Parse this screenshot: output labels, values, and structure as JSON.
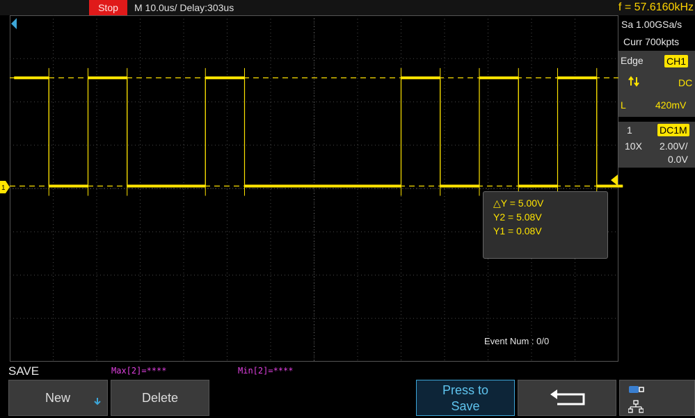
{
  "topbar": {
    "status": "Stop",
    "timebase": "M 10.0us/  Delay:303us",
    "frequency": "f = 57.6160kHz"
  },
  "acquisition": {
    "sample_rate": "Sa 1.00GSa/s",
    "memory": "Curr 700kpts"
  },
  "trigger": {
    "type": "Edge",
    "source": "CH1",
    "slope_icon": "rising-falling-edge-icon",
    "coupling": "DC",
    "level_label": "L",
    "level": "420mV"
  },
  "channel": {
    "number": "1",
    "coupling_badge": "DC1M",
    "probe": "10X",
    "scale": "2.00V/",
    "offset": "0.0V",
    "color": "#ffe400"
  },
  "cursor": {
    "delta_y": "△Y = 5.00V",
    "y2": "Y2 = 5.08V",
    "y1": "Y1 = 0.08V"
  },
  "event_num": "Event Num : 0/0",
  "waveform": {
    "high_level_v": 5.08,
    "low_level_v": 0.08,
    "channel_marker": "1",
    "segments": [
      {
        "start_div": 0.1,
        "end_div": 0.9,
        "level": "high"
      },
      {
        "start_div": 0.9,
        "end_div": 1.8,
        "level": "low"
      },
      {
        "start_div": 1.8,
        "end_div": 2.7,
        "level": "high"
      },
      {
        "start_div": 2.7,
        "end_div": 4.5,
        "level": "low"
      },
      {
        "start_div": 4.5,
        "end_div": 5.4,
        "level": "high"
      },
      {
        "start_div": 5.4,
        "end_div": 9.0,
        "level": "low"
      },
      {
        "start_div": 9.0,
        "end_div": 9.9,
        "level": "high"
      },
      {
        "start_div": 9.9,
        "end_div": 10.8,
        "level": "low"
      },
      {
        "start_div": 10.8,
        "end_div": 11.7,
        "level": "high"
      },
      {
        "start_div": 11.7,
        "end_div": 12.6,
        "level": "low"
      },
      {
        "start_div": 12.6,
        "end_div": 13.5,
        "level": "high"
      },
      {
        "start_div": 13.5,
        "end_div": 14.1,
        "level": "low"
      }
    ]
  },
  "menu": {
    "title": "SAVE",
    "max_label": "Max[2]=****",
    "min_label": "Min[2]=****",
    "buttons": {
      "new": "New",
      "delete": "Delete",
      "press_to_save_line1": "Press to",
      "press_to_save_line2": "Save",
      "back_icon": "return-arrow-icon",
      "status_icons": [
        "usb-storage-icon",
        "network-icon"
      ]
    }
  }
}
